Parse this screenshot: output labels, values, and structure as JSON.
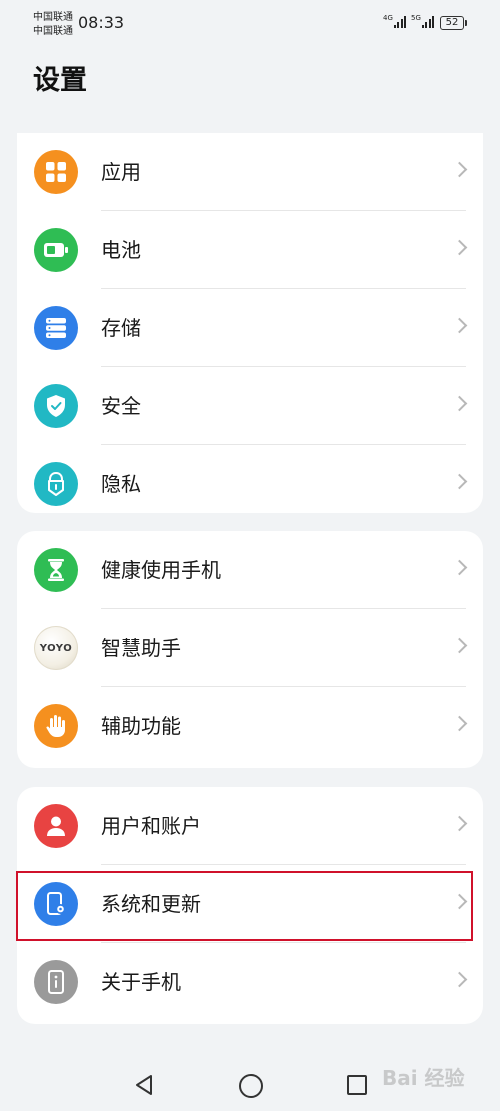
{
  "status_bar": {
    "carrier_1": "中国联通",
    "carrier_2": "中国联通",
    "time": "08:33",
    "network_1": "4G",
    "network_2": "5G",
    "battery": "52"
  },
  "header": {
    "title": "设置"
  },
  "groups": [
    {
      "items": [
        {
          "label": "应用",
          "icon": "apps-grid-icon",
          "color": "#f5901f"
        },
        {
          "label": "电池",
          "icon": "battery-icon",
          "color": "#2fbd54"
        },
        {
          "label": "存储",
          "icon": "storage-icon",
          "color": "#2f7fe8"
        },
        {
          "label": "安全",
          "icon": "shield-check-icon",
          "color": "#21b8c4"
        },
        {
          "label": "隐私",
          "icon": "privacy-lock-icon",
          "color": "#21b8c4"
        }
      ]
    },
    {
      "items": [
        {
          "label": "健康使用手机",
          "icon": "hourglass-icon",
          "color": "#2fbd54"
        },
        {
          "label": "智慧助手",
          "icon": "yoyo-assistant-icon",
          "icon_text": "YOYO",
          "color": "#c9a24a"
        },
        {
          "label": "辅助功能",
          "icon": "hand-icon",
          "color": "#f5901f"
        }
      ]
    },
    {
      "items": [
        {
          "label": "用户和账户",
          "icon": "user-icon",
          "color": "#e84342"
        },
        {
          "label": "系统和更新",
          "icon": "phone-settings-icon",
          "color": "#2f7fe8"
        },
        {
          "label": "关于手机",
          "icon": "phone-info-icon",
          "color": "#9a9a9a"
        }
      ]
    }
  ],
  "highlight_color": "#d0112b",
  "watermark": "Bai 经验"
}
